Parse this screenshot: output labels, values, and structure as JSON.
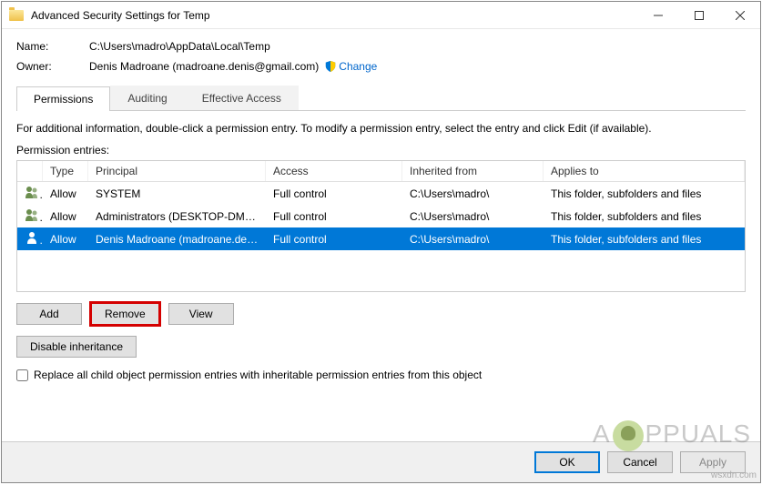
{
  "titlebar": {
    "title": "Advanced Security Settings for Temp"
  },
  "name_label": "Name:",
  "name_value": "C:\\Users\\madro\\AppData\\Local\\Temp",
  "owner_label": "Owner:",
  "owner_value": "Denis Madroane (madroane.denis@gmail.com)",
  "change_link": "Change",
  "tabs": {
    "permissions": "Permissions",
    "auditing": "Auditing",
    "effective": "Effective Access"
  },
  "info_text": "For additional information, double-click a permission entry. To modify a permission entry, select the entry and click Edit (if available).",
  "entries_label": "Permission entries:",
  "columns": {
    "type": "Type",
    "principal": "Principal",
    "access": "Access",
    "inherited": "Inherited from",
    "applies": "Applies to"
  },
  "rows": [
    {
      "type": "Allow",
      "principal": "SYSTEM",
      "access": "Full control",
      "inherited": "C:\\Users\\madro\\",
      "applies": "This folder, subfolders and files",
      "selected": false
    },
    {
      "type": "Allow",
      "principal": "Administrators (DESKTOP-DMO...",
      "access": "Full control",
      "inherited": "C:\\Users\\madro\\",
      "applies": "This folder, subfolders and files",
      "selected": false
    },
    {
      "type": "Allow",
      "principal": "Denis Madroane (madroane.deni...",
      "access": "Full control",
      "inherited": "C:\\Users\\madro\\",
      "applies": "This folder, subfolders and files",
      "selected": true
    }
  ],
  "buttons": {
    "add": "Add",
    "remove": "Remove",
    "view": "View",
    "disable_inh": "Disable inheritance"
  },
  "replace_checkbox": "Replace all child object permission entries with inheritable permission entries from this object",
  "footer": {
    "ok": "OK",
    "cancel": "Cancel",
    "apply": "Apply"
  },
  "watermark": "A PPUALS",
  "wsxdn": "wsxdn.com"
}
